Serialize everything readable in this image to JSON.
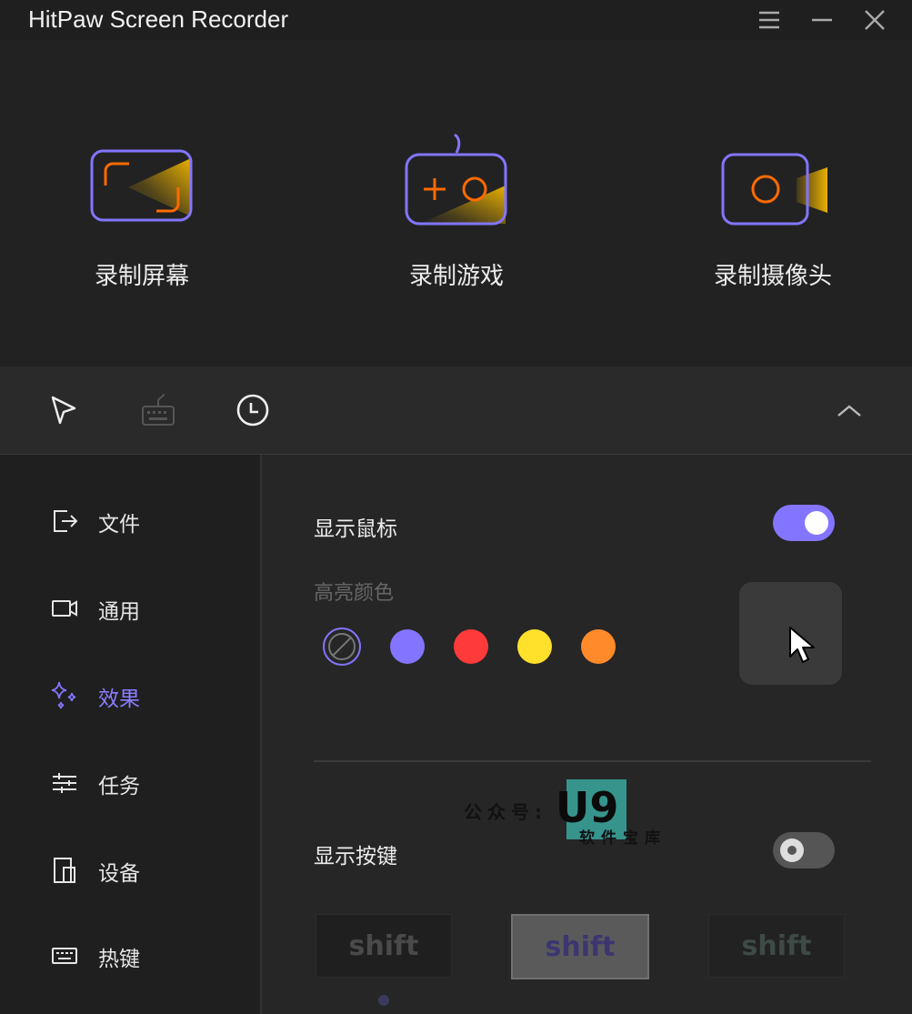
{
  "window": {
    "title": "HitPaw Screen Recorder",
    "controls": [
      "menu-icon",
      "minimize-icon",
      "close-icon"
    ]
  },
  "modes": [
    {
      "label": "录制屏幕",
      "icon": "screen-record-icon"
    },
    {
      "label": "录制游戏",
      "icon": "gamepad-icon"
    },
    {
      "label": "录制摄像头",
      "icon": "camera-icon"
    }
  ],
  "toolbar": {
    "icons": [
      "cursor-icon",
      "keyboard-icon",
      "clock-icon"
    ],
    "collapse_icon": "chevron-up-icon"
  },
  "sidebar": {
    "items": [
      {
        "label": "文件",
        "icon": "file-export-icon",
        "active": false
      },
      {
        "label": "通用",
        "icon": "video-icon",
        "active": false
      },
      {
        "label": "效果",
        "icon": "sparkle-icon",
        "active": true
      },
      {
        "label": "任务",
        "icon": "sliders-icon",
        "active": false
      },
      {
        "label": "设备",
        "icon": "device-icon",
        "active": false
      },
      {
        "label": "热键",
        "icon": "keyboard-icon",
        "active": false
      }
    ]
  },
  "effects": {
    "show_mouse_label": "显示鼠标",
    "show_mouse_enabled": true,
    "highlight_color_label": "高亮颜色",
    "colors": [
      "none",
      "#8375ff",
      "#ff3a3a",
      "#ffe02a",
      "#ff8a2a"
    ],
    "selected_color": "none",
    "show_keys_label": "显示按键",
    "show_keys_enabled": false,
    "key_styles": [
      "shift",
      "shift",
      "shift"
    ]
  },
  "watermark": {
    "prefix": "公众号:",
    "brand": "U9",
    "sub": "软件宝库"
  },
  "colors": {
    "accent": "#8375ff",
    "orange": "#ff6a00",
    "gold": "#e0a800"
  }
}
